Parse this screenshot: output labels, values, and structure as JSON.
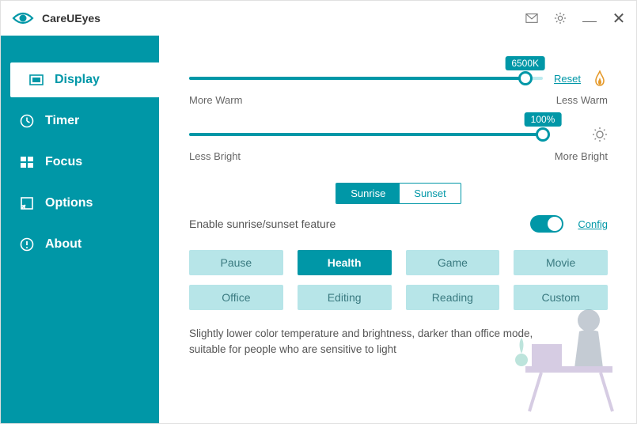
{
  "app": {
    "title": "CareUEyes"
  },
  "nav": [
    {
      "label": "Display",
      "icon": "display",
      "active": true
    },
    {
      "label": "Timer",
      "icon": "timer",
      "active": false
    },
    {
      "label": "Focus",
      "icon": "focus",
      "active": false
    },
    {
      "label": "Options",
      "icon": "options",
      "active": false
    },
    {
      "label": "About",
      "icon": "about",
      "active": false
    }
  ],
  "temp": {
    "value_label": "6500K",
    "percent": 95,
    "left_label": "More Warm",
    "right_label": "Less Warm",
    "reset": "Reset"
  },
  "bright": {
    "value_label": "100%",
    "percent": 100,
    "left_label": "Less Bright",
    "right_label": "More Bright"
  },
  "segment": {
    "sunrise": "Sunrise",
    "sunset": "Sunset",
    "active": "sunrise"
  },
  "feature": {
    "label": "Enable sunrise/sunset feature",
    "config": "Config",
    "enabled": true
  },
  "modes": [
    {
      "label": "Pause",
      "active": false
    },
    {
      "label": "Health",
      "active": true
    },
    {
      "label": "Game",
      "active": false
    },
    {
      "label": "Movie",
      "active": false
    },
    {
      "label": "Office",
      "active": false
    },
    {
      "label": "Editing",
      "active": false
    },
    {
      "label": "Reading",
      "active": false
    },
    {
      "label": "Custom",
      "active": false
    }
  ],
  "description": "Slightly lower color temperature and brightness, darker than office mode, suitable for people who are sensitive to light"
}
